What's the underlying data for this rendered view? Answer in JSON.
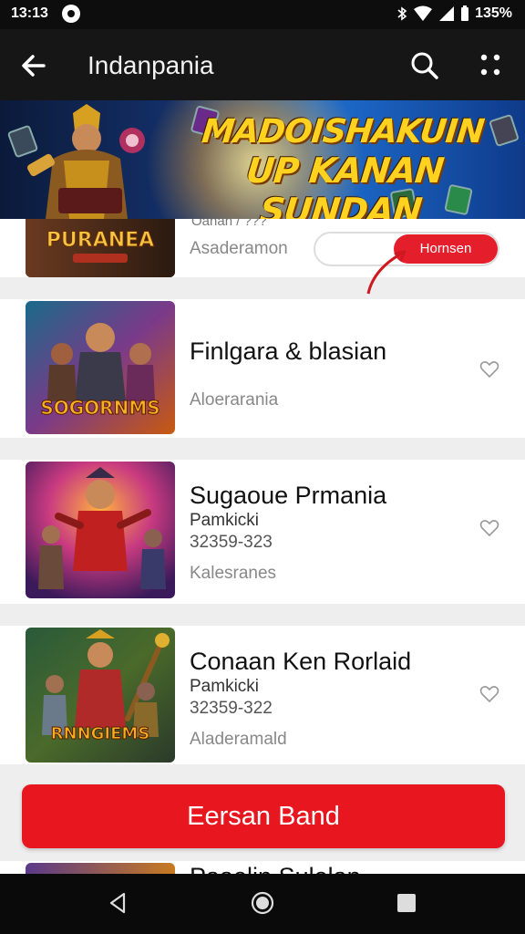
{
  "status_bar": {
    "time": "13:13",
    "battery_text": "135%"
  },
  "app_bar": {
    "title": "Indanpania"
  },
  "banner": {
    "line1": "MADOISHAKUIN",
    "line2": "UP KANAN SUNDAN",
    "hero_text": "PURANEA"
  },
  "partial_card": {
    "head": "Oanan / ???",
    "status": "Asaderamon",
    "button_label": "Hornsen"
  },
  "games": [
    {
      "title": "Finlgara & blasian",
      "subtitle": "",
      "price": "",
      "status": "Aloerarania",
      "thumb_text": "SOGORNMS"
    },
    {
      "title": "Sugaoue Prmania",
      "subtitle": "Pamkicki",
      "price": "32359-323",
      "status": "Kalesranes",
      "thumb_text": ""
    },
    {
      "title": "Conaan Ken Rorlaid",
      "subtitle": "Pamkicki",
      "price": "32359-322",
      "status": "Aladeramald",
      "thumb_text": "RNNGIEMS"
    }
  ],
  "cta": {
    "label": "Eersan Band"
  },
  "bottom_peek": {
    "title": "Paaelin Sulelan"
  },
  "colors": {
    "accent": "#e8171f",
    "app_bar": "#161616",
    "banner_text": "#ffd21f"
  },
  "icons": {
    "back": "arrow-left-icon",
    "search": "search-icon",
    "more": "more-vert-icon",
    "favorite": "heart-outline-icon",
    "nav_back": "nav-back-triangle-icon",
    "nav_home": "nav-home-circle-icon",
    "nav_recent": "nav-recent-square-icon"
  }
}
